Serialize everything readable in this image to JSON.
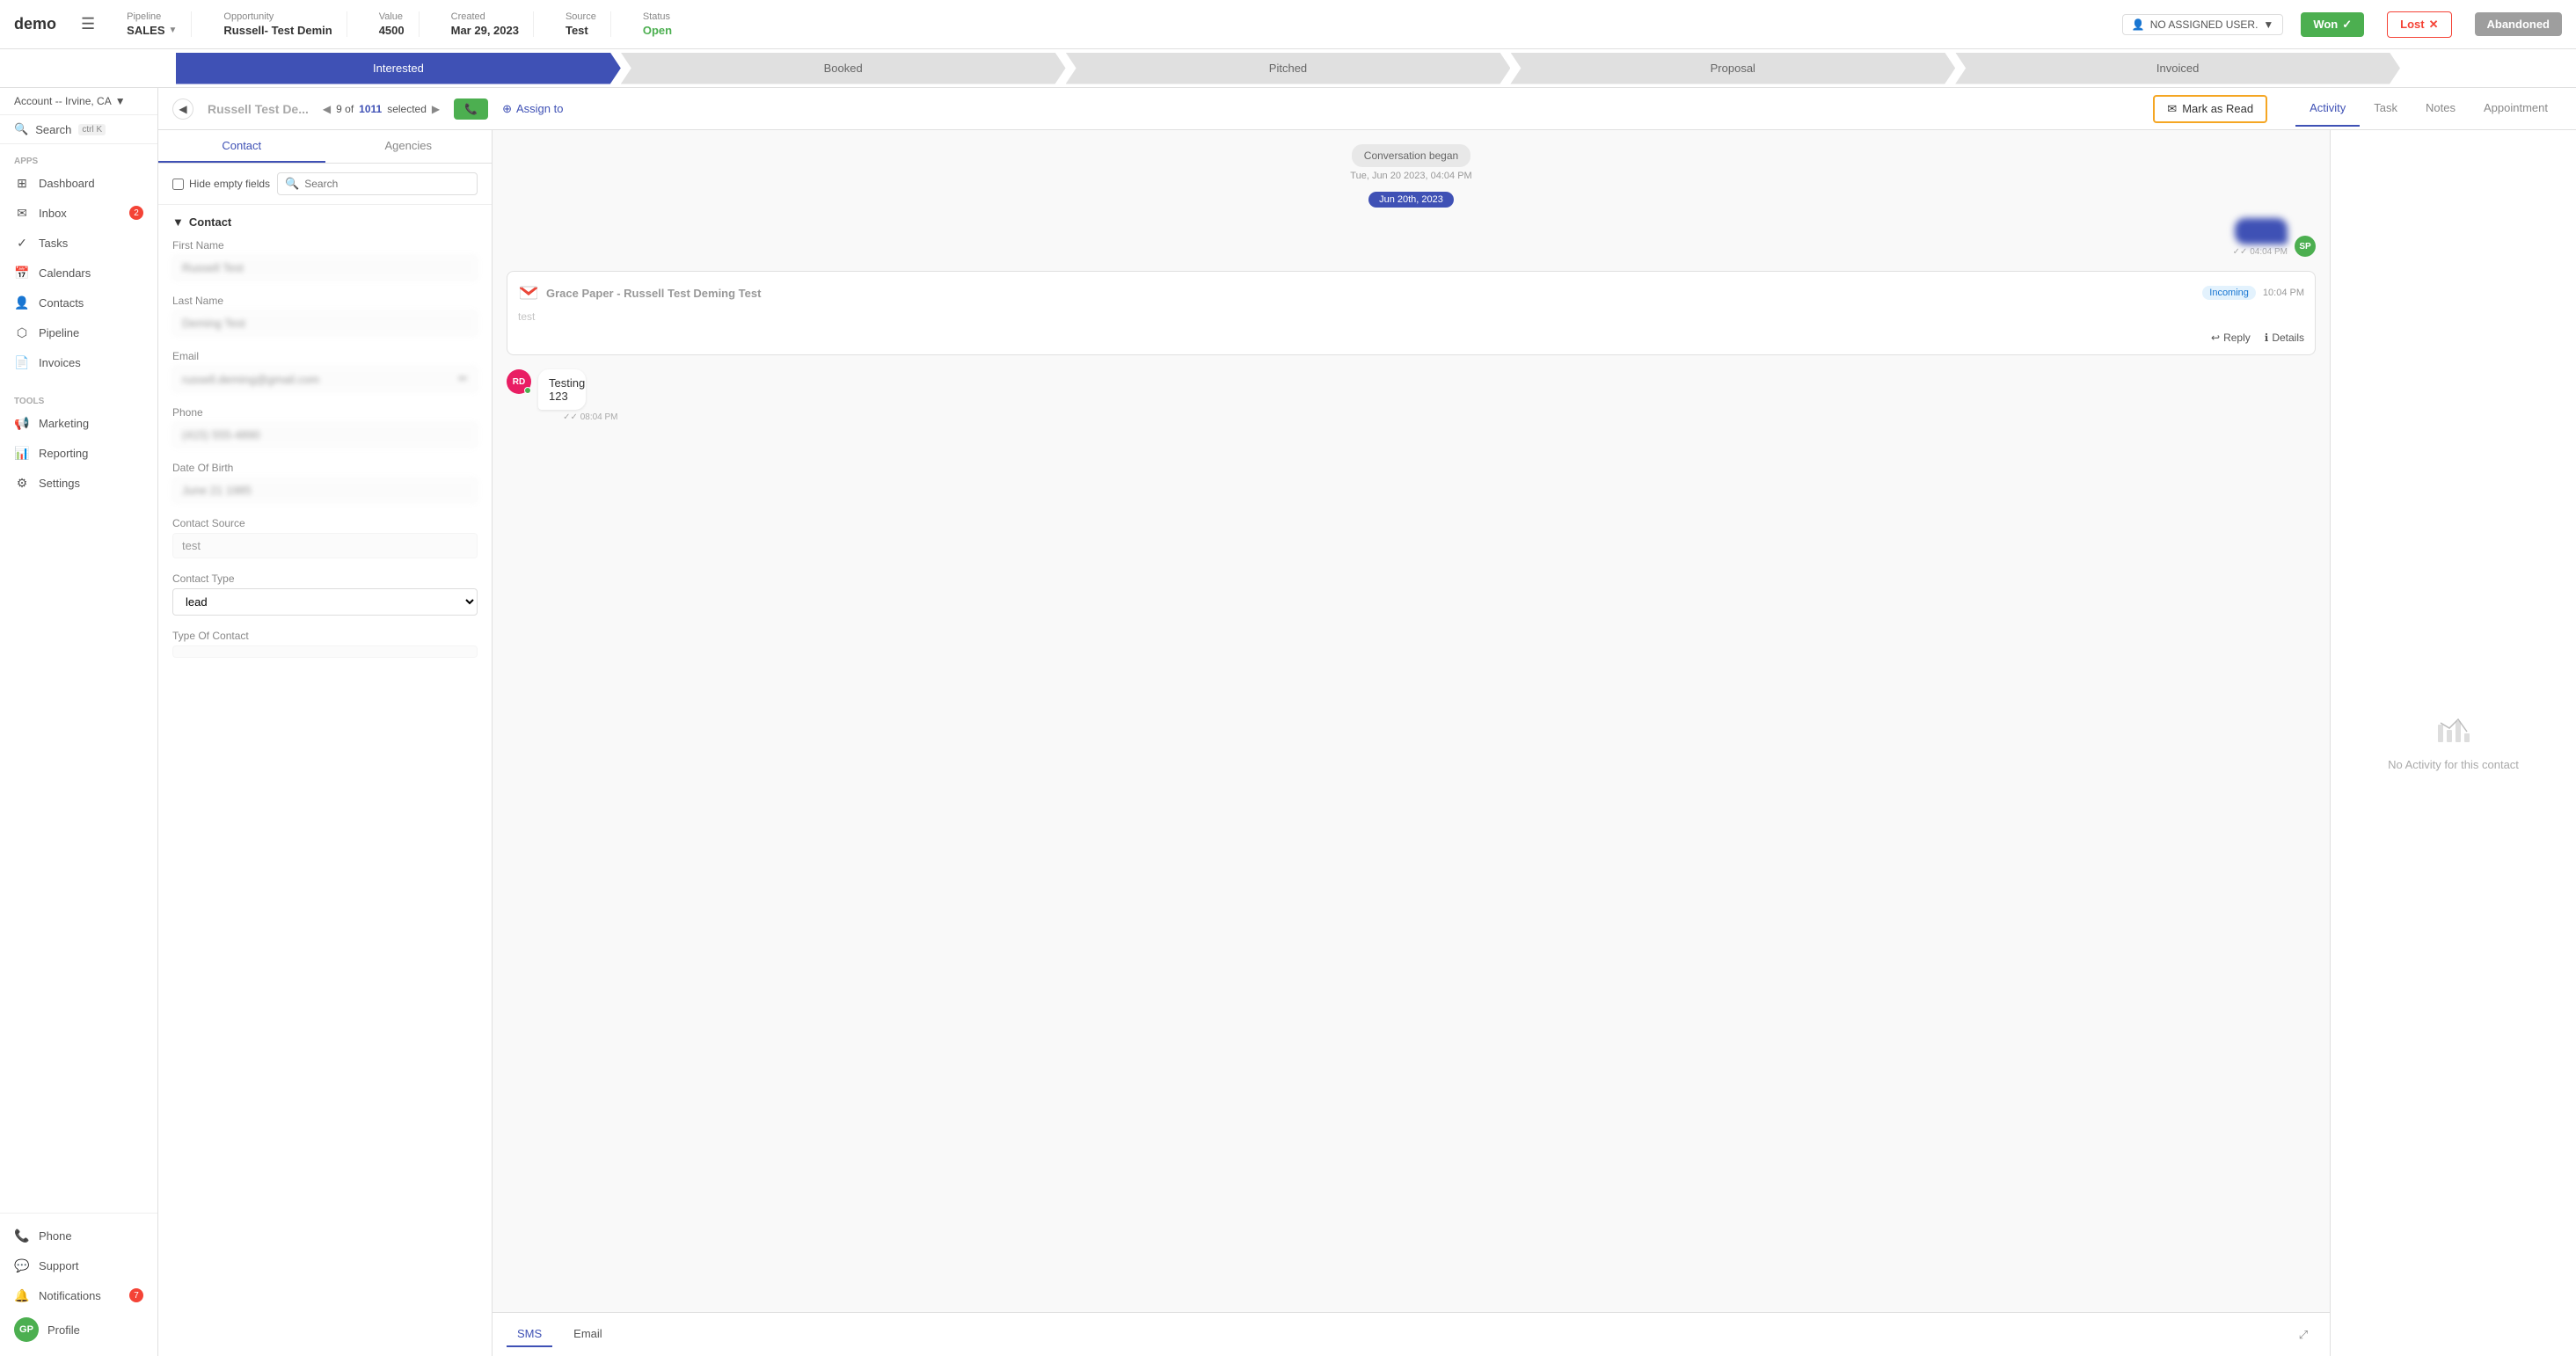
{
  "app": {
    "logo": "demo",
    "hamburger": "☰"
  },
  "header": {
    "pipeline_label": "Pipeline",
    "pipeline_value": "SALES",
    "opportunity_label": "Opportunity",
    "opportunity_value": "Russell- Test Demin",
    "value_label": "Value",
    "value_value": "4500",
    "created_label": "Created",
    "created_value": "Mar 29, 2023",
    "source_label": "Source",
    "source_value": "Test",
    "status_label": "Status",
    "status_value": "Open",
    "assigned_user": "NO ASSIGNED USER.",
    "won_label": "Won",
    "lost_label": "Lost",
    "abandoned_label": "Abandoned"
  },
  "stages": [
    {
      "label": "Interested",
      "state": "active"
    },
    {
      "label": "Booked",
      "state": "normal"
    },
    {
      "label": "Pitched",
      "state": "normal"
    },
    {
      "label": "Proposal",
      "state": "normal"
    },
    {
      "label": "Invoiced",
      "state": "normal"
    }
  ],
  "sidebar": {
    "account": "Account -- Irvine, CA",
    "search_label": "Search",
    "search_kbd": "ctrl K",
    "apps_label": "Apps",
    "nav_items": [
      {
        "id": "dashboard",
        "label": "Dashboard",
        "icon": "⊞"
      },
      {
        "id": "inbox",
        "label": "Inbox",
        "icon": "✉",
        "badge": "2"
      },
      {
        "id": "tasks",
        "label": "Tasks",
        "icon": "✓"
      },
      {
        "id": "calendars",
        "label": "Calendars",
        "icon": "📅"
      },
      {
        "id": "contacts",
        "label": "Contacts",
        "icon": "👤"
      },
      {
        "id": "pipeline",
        "label": "Pipeline",
        "icon": "⬡"
      },
      {
        "id": "invoices",
        "label": "Invoices",
        "icon": "📄"
      }
    ],
    "tools_label": "Tools",
    "tool_items": [
      {
        "id": "marketing",
        "label": "Marketing",
        "icon": "📢"
      },
      {
        "id": "reporting",
        "label": "Reporting",
        "icon": "📊"
      },
      {
        "id": "settings",
        "label": "Settings",
        "icon": "⚙"
      }
    ],
    "bottom_items": [
      {
        "id": "phone",
        "label": "Phone",
        "icon": "📞"
      },
      {
        "id": "support",
        "label": "Support",
        "icon": "💬"
      },
      {
        "id": "notifications",
        "label": "Notifications",
        "icon": "🔔",
        "badge": "7"
      },
      {
        "id": "profile",
        "label": "Profile",
        "icon": "GP"
      }
    ]
  },
  "sub_header": {
    "contact_name": "Russell Test De...",
    "pagination": "9 of",
    "pagination_total": "1011",
    "pagination_suffix": "selected",
    "phone_btn": "📞",
    "assign_label": "Assign to",
    "mark_as_read": "Mark as Read"
  },
  "tabs": [
    {
      "id": "activity",
      "label": "Activity",
      "active": true
    },
    {
      "id": "task",
      "label": "Task"
    },
    {
      "id": "notes",
      "label": "Notes"
    },
    {
      "id": "appointment",
      "label": "Appointment"
    }
  ],
  "contact_panel": {
    "tabs": [
      "Contact",
      "Agencies"
    ],
    "active_tab": "Contact",
    "hide_empty_label": "Hide empty fields",
    "search_placeholder": "Search",
    "section_label": "Contact",
    "fields": [
      {
        "label": "First Name",
        "value": "Russell Test",
        "blurred": true
      },
      {
        "label": "Last Name",
        "value": "Deming Test",
        "blurred": true
      },
      {
        "label": "Email",
        "value": "russell.deming@gmail.com",
        "blurred": true,
        "has_edit": true
      },
      {
        "label": "Phone",
        "value": "(415) 555-4890",
        "blurred": true
      },
      {
        "label": "Date Of Birth",
        "value": "June 21 1985",
        "blurred": true
      },
      {
        "label": "Contact Source",
        "value": "test",
        "blurred": false
      },
      {
        "label": "Contact Type",
        "value": "lead",
        "is_select": true
      },
      {
        "label": "Type Of Contact",
        "value": ""
      }
    ]
  },
  "chat": {
    "conversation_began": "Conversation began",
    "conversation_date": "Tue, Jun 20 2023, 04:04 PM",
    "date_divider": "Jun 20th, 2023",
    "messages": [
      {
        "type": "outgoing",
        "text": "Hey!",
        "time": "04:04 PM",
        "avatar": "SP",
        "blurred": true
      },
      {
        "type": "email",
        "subject": "Grace Paper - Russell Test Deming Test",
        "preview": "test",
        "time": "10:04 PM",
        "badge": "Incoming"
      },
      {
        "type": "incoming_with_avatar",
        "text": "Testing 123",
        "time": "08:04 PM",
        "avatar": "RD",
        "online": true
      }
    ],
    "input_tabs": [
      "SMS",
      "Email"
    ],
    "active_input_tab": "SMS"
  },
  "activity_panel": {
    "empty_label": "No Activity for this contact"
  },
  "annotation": {
    "arrow_text": "Mark as Read"
  }
}
